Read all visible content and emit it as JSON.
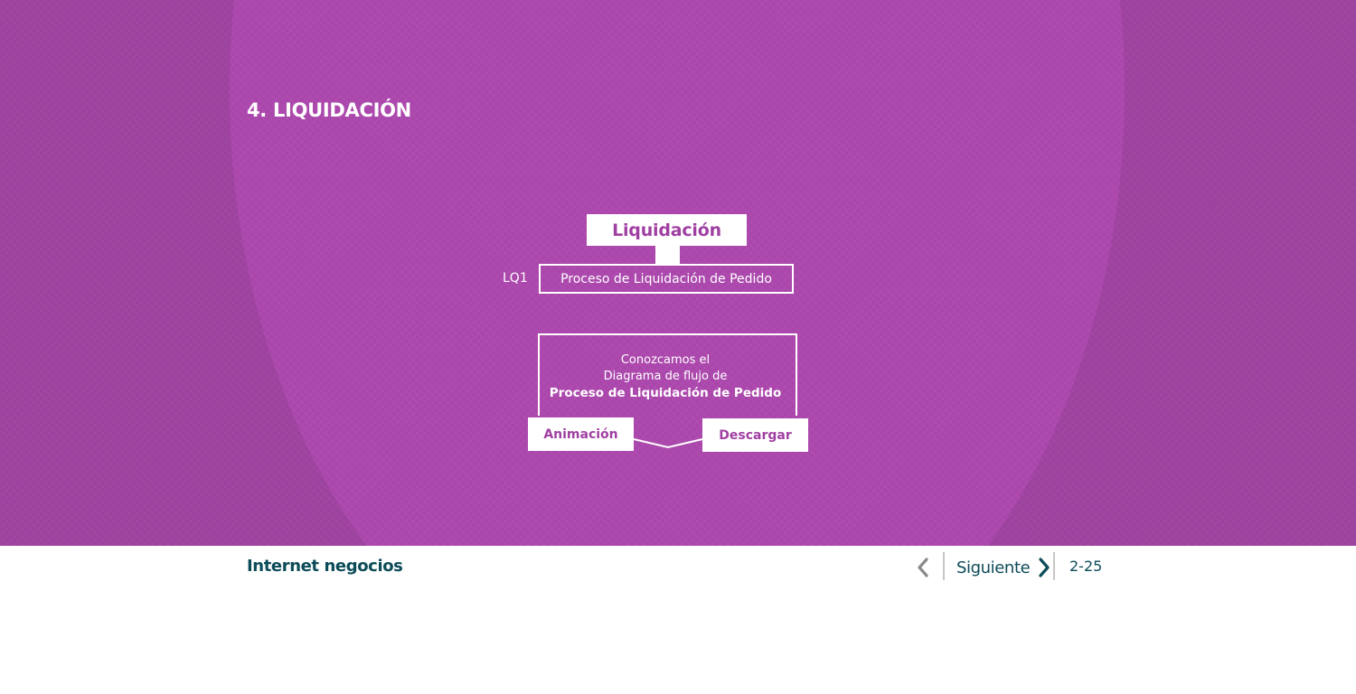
{
  "section": {
    "title": "4. LIQUIDACIÓN"
  },
  "diagram": {
    "title": "Liquidación",
    "code": "LQ1",
    "process": "Proceso de Liquidación de Pedido"
  },
  "info": {
    "line1": "Conozcamos el",
    "line2": "Diagrama de flujo de",
    "line3": "Proceso de Liquidación de Pedido",
    "animation_button": "Animación",
    "download_button": "Descargar"
  },
  "footer": {
    "brand": "Internet negocios",
    "next_label": "Siguiente",
    "page": "2-25"
  },
  "colors": {
    "stage_bg": "#9d429f",
    "stage_circle": "#ab47ac",
    "accent_text": "#a03fa2",
    "footer_text": "#0c4b58"
  }
}
